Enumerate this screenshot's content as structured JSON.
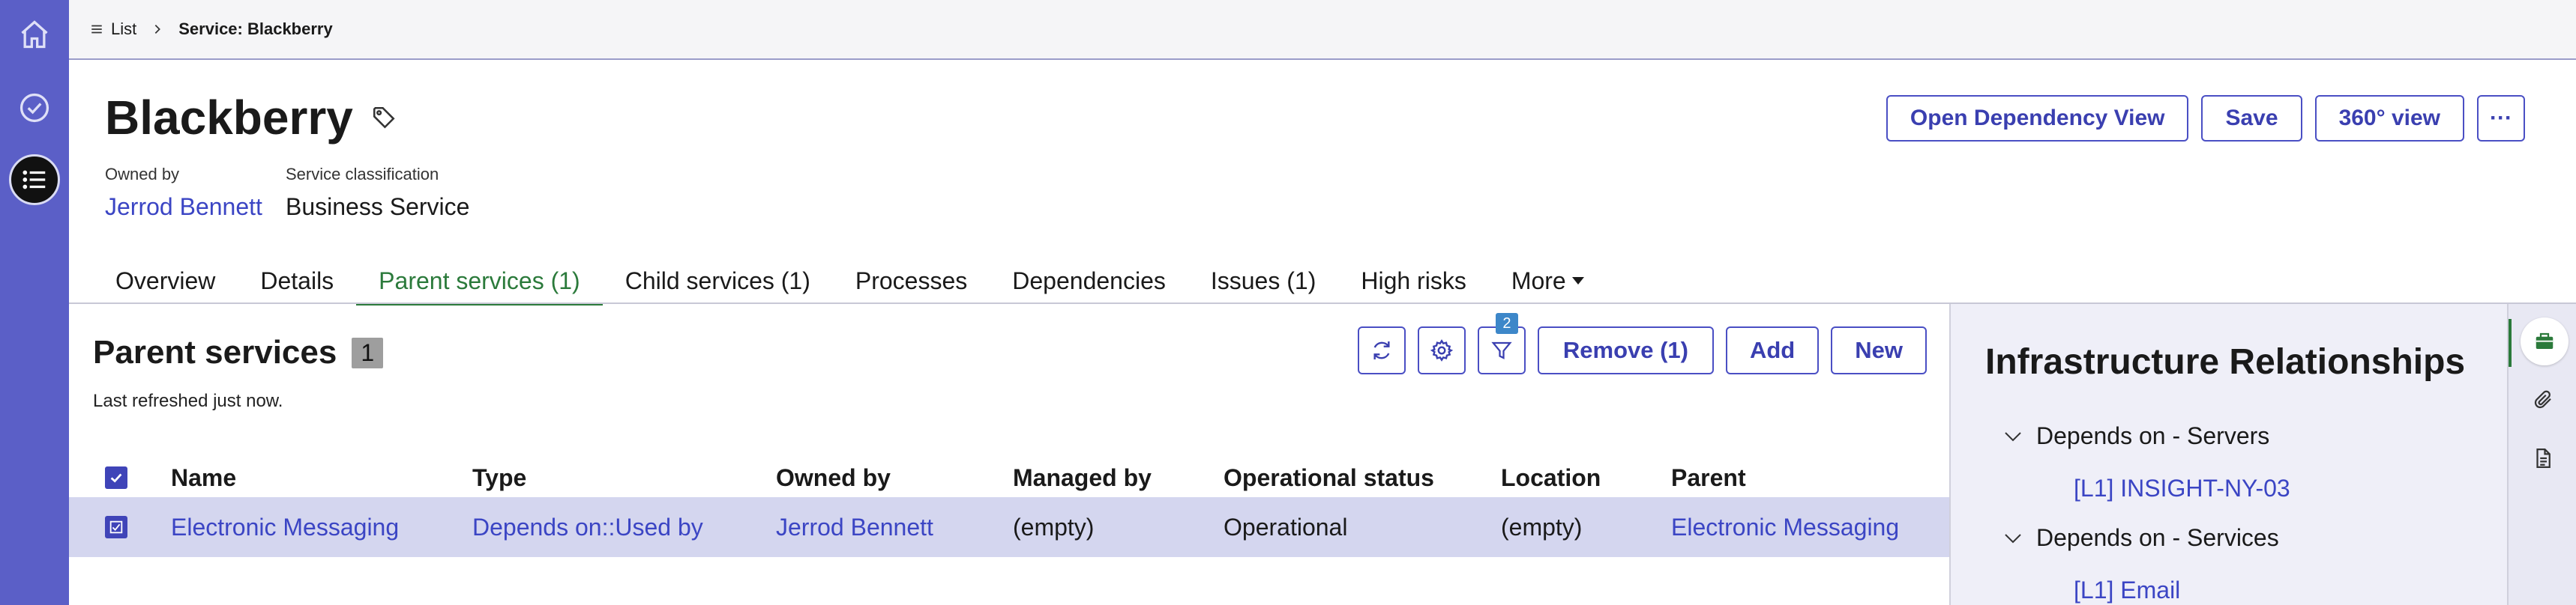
{
  "breadcrumb": {
    "list_label": "List",
    "current": "Service: Blackberry"
  },
  "record": {
    "title": "Blackberry",
    "owned_by_label": "Owned by",
    "owned_by_value": "Jerrod Bennett",
    "classification_label": "Service classification",
    "classification_value": "Business Service"
  },
  "actions": {
    "dependency_view": "Open Dependency View",
    "save": "Save",
    "view_360": "360° view",
    "more": "···"
  },
  "tabs": [
    {
      "label": "Overview"
    },
    {
      "label": "Details"
    },
    {
      "label": "Parent services (1)"
    },
    {
      "label": "Child services (1)"
    },
    {
      "label": "Processes"
    },
    {
      "label": "Dependencies"
    },
    {
      "label": "Issues (1)"
    },
    {
      "label": "High risks"
    },
    {
      "label": "More"
    }
  ],
  "list": {
    "title": "Parent services",
    "count": "1",
    "refreshed": "Last refreshed just now.",
    "filter_count": "2",
    "remove_label": "Remove (1)",
    "add_label": "Add",
    "new_label": "New",
    "columns": [
      "Name",
      "Type",
      "Owned by",
      "Managed by",
      "Operational status",
      "Location",
      "Parent"
    ],
    "rows": [
      {
        "name": "Electronic Messaging",
        "type": "Depends on::Used by",
        "owned_by": "Jerrod Bennett",
        "managed_by": "(empty)",
        "status": "Operational",
        "location": "(empty)",
        "parent": "Electronic Messaging"
      }
    ]
  },
  "infra": {
    "title": "Infrastructure Relationships",
    "groups": [
      {
        "label": "Depends on - Servers",
        "item": "[L1] INSIGHT-NY-03"
      },
      {
        "label": "Depends on - Services",
        "item": "[L1] Email"
      }
    ]
  },
  "colors": {
    "nav": "#5b5fc7",
    "accent": "#3b45c4",
    "active_tab": "#2b7a3b",
    "selected_row": "#d4d6ef"
  }
}
